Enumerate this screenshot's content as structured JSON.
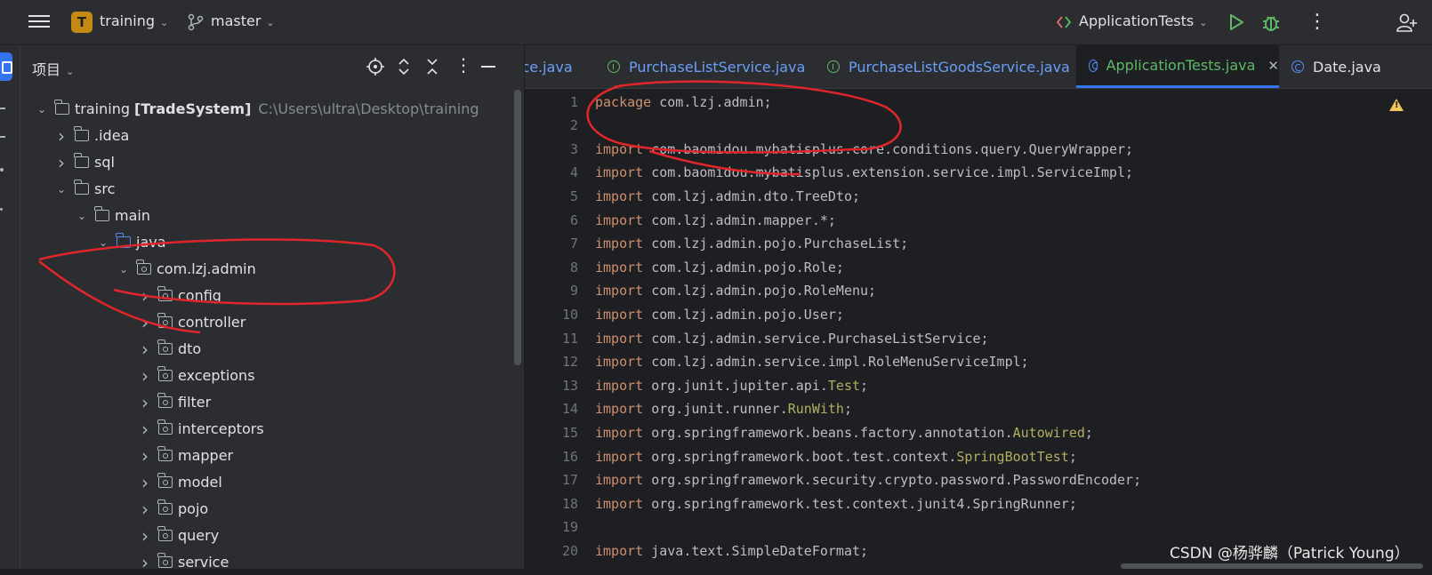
{
  "titlebar": {
    "project_badge": "T",
    "project_name": "training",
    "branch": "master",
    "run_config": "ApplicationTests"
  },
  "project_panel": {
    "title": "项目",
    "tree": [
      {
        "label": "training",
        "label_bold": "[TradeSystem]",
        "path": "C:\\Users\\ultra\\Desktop\\training",
        "depth": 0,
        "expanded": true,
        "icon": "module-icon"
      },
      {
        "label": ".idea",
        "depth": 1,
        "expanded": false,
        "icon": "folder-icon"
      },
      {
        "label": "sql",
        "depth": 1,
        "expanded": false,
        "icon": "folder-icon"
      },
      {
        "label": "src",
        "depth": 1,
        "expanded": true,
        "icon": "folder-icon"
      },
      {
        "label": "main",
        "depth": 2,
        "expanded": true,
        "icon": "folder-icon"
      },
      {
        "label": "java",
        "depth": 3,
        "expanded": true,
        "icon": "source-folder-icon"
      },
      {
        "label": "com.lzj.admin",
        "depth": 4,
        "expanded": true,
        "icon": "package-icon"
      },
      {
        "label": "config",
        "depth": 5,
        "expanded": false,
        "icon": "package-icon"
      },
      {
        "label": "controller",
        "depth": 5,
        "expanded": false,
        "icon": "package-icon"
      },
      {
        "label": "dto",
        "depth": 5,
        "expanded": false,
        "icon": "package-icon"
      },
      {
        "label": "exceptions",
        "depth": 5,
        "expanded": false,
        "icon": "package-icon"
      },
      {
        "label": "filter",
        "depth": 5,
        "expanded": false,
        "icon": "package-icon"
      },
      {
        "label": "interceptors",
        "depth": 5,
        "expanded": false,
        "icon": "package-icon"
      },
      {
        "label": "mapper",
        "depth": 5,
        "expanded": false,
        "icon": "package-icon"
      },
      {
        "label": "model",
        "depth": 5,
        "expanded": false,
        "icon": "package-icon"
      },
      {
        "label": "pojo",
        "depth": 5,
        "expanded": false,
        "icon": "package-icon"
      },
      {
        "label": "query",
        "depth": 5,
        "expanded": false,
        "icon": "package-icon"
      },
      {
        "label": "service",
        "depth": 5,
        "expanded": false,
        "icon": "package-icon"
      }
    ]
  },
  "tabs": [
    {
      "label": "ice.java",
      "icon": "none",
      "active": false
    },
    {
      "label": "PurchaseListService.java",
      "icon": "interface-icon",
      "active": false
    },
    {
      "label": "PurchaseListGoodsService.java",
      "icon": "interface-icon",
      "active": false
    },
    {
      "label": "ApplicationTests.java",
      "icon": "class-icon",
      "active": true
    },
    {
      "label": "Date.java",
      "icon": "class-icon",
      "active": false
    }
  ],
  "code_lines": [
    {
      "n": "1",
      "kw": "package",
      "rest": " com.lzj.admin;",
      "ann": "",
      "tail": ""
    },
    {
      "n": "2",
      "kw": "",
      "rest": "",
      "ann": "",
      "tail": ""
    },
    {
      "n": "3",
      "kw": "import",
      "rest": " com.baomidou.mybatisplus.core.conditions.query.QueryWrapper;",
      "ann": "",
      "tail": ""
    },
    {
      "n": "4",
      "kw": "import",
      "rest": " com.baomidou.mybatisplus.extension.service.impl.ServiceImpl;",
      "ann": "",
      "tail": ""
    },
    {
      "n": "5",
      "kw": "import",
      "rest": " com.lzj.admin.dto.TreeDto;",
      "ann": "",
      "tail": ""
    },
    {
      "n": "6",
      "kw": "import",
      "rest": " com.lzj.admin.mapper.*;",
      "ann": "",
      "tail": ""
    },
    {
      "n": "7",
      "kw": "import",
      "rest": " com.lzj.admin.pojo.PurchaseList;",
      "ann": "",
      "tail": ""
    },
    {
      "n": "8",
      "kw": "import",
      "rest": " com.lzj.admin.pojo.Role;",
      "ann": "",
      "tail": ""
    },
    {
      "n": "9",
      "kw": "import",
      "rest": " com.lzj.admin.pojo.RoleMenu;",
      "ann": "",
      "tail": ""
    },
    {
      "n": "10",
      "kw": "import",
      "rest": " com.lzj.admin.pojo.User;",
      "ann": "",
      "tail": ""
    },
    {
      "n": "11",
      "kw": "import",
      "rest": " com.lzj.admin.service.PurchaseListService;",
      "ann": "",
      "tail": ""
    },
    {
      "n": "12",
      "kw": "import",
      "rest": " com.lzj.admin.service.impl.RoleMenuServiceImpl;",
      "ann": "",
      "tail": ""
    },
    {
      "n": "13",
      "kw": "import",
      "rest": " org.junit.jupiter.api.",
      "ann": "Test",
      "tail": ";"
    },
    {
      "n": "14",
      "kw": "import",
      "rest": " org.junit.runner.",
      "ann": "RunWith",
      "tail": ";"
    },
    {
      "n": "15",
      "kw": "import",
      "rest": " org.springframework.beans.factory.annotation.",
      "ann": "Autowired",
      "tail": ";"
    },
    {
      "n": "16",
      "kw": "import",
      "rest": " org.springframework.boot.test.context.",
      "ann": "SpringBootTest",
      "tail": ";"
    },
    {
      "n": "17",
      "kw": "import",
      "rest": " org.springframework.security.crypto.password.PasswordEncoder;",
      "ann": "",
      "tail": ""
    },
    {
      "n": "18",
      "kw": "import",
      "rest": " org.springframework.test.context.junit4.SpringRunner;",
      "ann": "",
      "tail": ""
    },
    {
      "n": "19",
      "kw": "",
      "rest": "",
      "ann": "",
      "tail": ""
    },
    {
      "n": "20",
      "kw": "import",
      "rest": " java.text.SimpleDateFormat;",
      "ann": "",
      "tail": ""
    }
  ],
  "watermark": "CSDN @杨骅麟（Patrick Young）",
  "colors": {
    "accent": "#3574f0",
    "keyword": "#cf8e6d",
    "annotation": "#b3ae60",
    "markup_red": "#e0262b"
  }
}
